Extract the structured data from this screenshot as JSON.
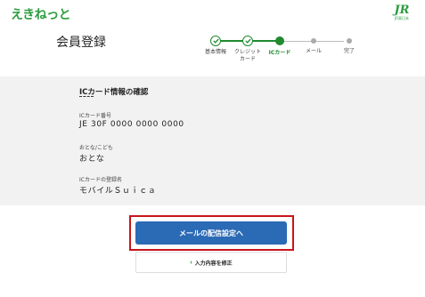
{
  "header": {
    "logo_text": "えきねっと",
    "jr_logo_text": "JR",
    "jr_logo_sub": "JR東日本"
  },
  "page": {
    "title": "会員登録"
  },
  "stepper": {
    "steps": [
      {
        "label": "基本情報",
        "state": "done"
      },
      {
        "label": "クレジット\nカード",
        "state": "done"
      },
      {
        "label": "ICカード",
        "state": "current"
      },
      {
        "label": "メール",
        "state": "todo"
      },
      {
        "label": "完了",
        "state": "todo"
      }
    ]
  },
  "section": {
    "title": "ICカード情報の確認",
    "fields": [
      {
        "label": "ICカード番号",
        "value": "JE 30F 0000 0000 0000"
      },
      {
        "label": "おとな/こども",
        "value": "おとな"
      },
      {
        "label": "ICカードの登録名",
        "value": "モバイルＳｕｉｃａ"
      }
    ]
  },
  "actions": {
    "primary_label": "メールの配信設定へ",
    "secondary_label": "入力内容を修正",
    "secondary_icon": "chevron-left-icon"
  },
  "colors": {
    "brand_green": "#1f8a2e",
    "primary_blue": "#2b6ab5",
    "highlight_red": "#c8151b",
    "panel_gray": "#f2f2f2"
  }
}
